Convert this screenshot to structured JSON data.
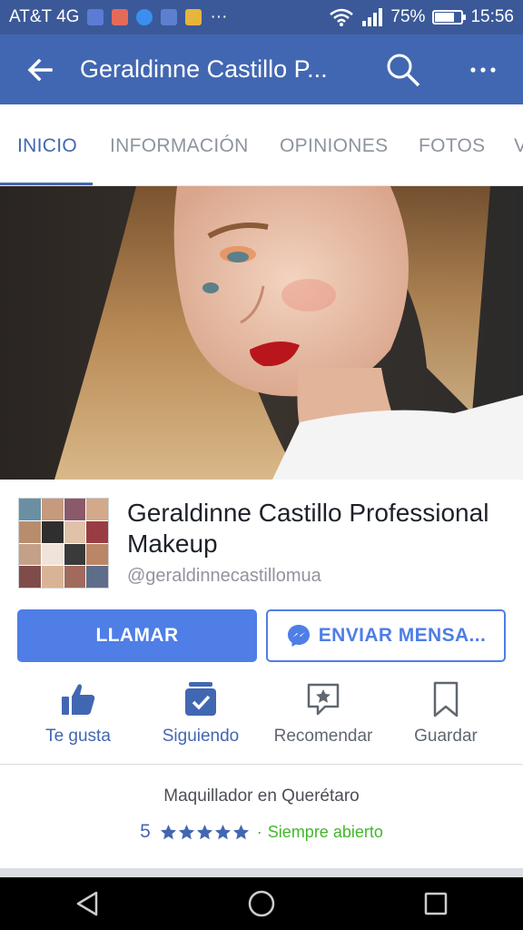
{
  "status_bar": {
    "carrier": "AT&T 4G",
    "battery_percent": "75%",
    "battery_level": 0.75,
    "time": "15:56",
    "notification_icons": [
      "sim-icon",
      "gift-icon",
      "messenger-icon",
      "facebook-icon",
      "app-icon",
      "more-notifications-icon"
    ]
  },
  "app_bar": {
    "title": "Geraldinne Castillo P...",
    "color": "#4267b2"
  },
  "tabs": [
    {
      "label": "INICIO",
      "active": true
    },
    {
      "label": "INFORMACIÓN",
      "active": false
    },
    {
      "label": "OPINIONES",
      "active": false
    },
    {
      "label": "FOTOS",
      "active": false
    },
    {
      "label": "V",
      "active": false
    }
  ],
  "page": {
    "name": "Geraldinne Castillo Professional Makeup",
    "handle": "@geraldinnecastillomua"
  },
  "buttons": {
    "call": "LLAMAR",
    "message": "ENVIAR MENSA..."
  },
  "actions": [
    {
      "label": "Te gusta",
      "icon": "thumbs-up-icon",
      "active": true
    },
    {
      "label": "Siguiendo",
      "icon": "following-icon",
      "active": true
    },
    {
      "label": "Recomendar",
      "icon": "recommend-icon",
      "active": false
    },
    {
      "label": "Guardar",
      "icon": "bookmark-icon",
      "active": false
    }
  ],
  "info": {
    "category": "Maquillador en Querétaro",
    "rating": "5",
    "stars": 5,
    "separator": "·",
    "hours": "Siempre abierto"
  },
  "colors": {
    "brand_blue": "#4267b2",
    "button_blue": "#4e7ee6",
    "open_green": "#42b72a"
  }
}
